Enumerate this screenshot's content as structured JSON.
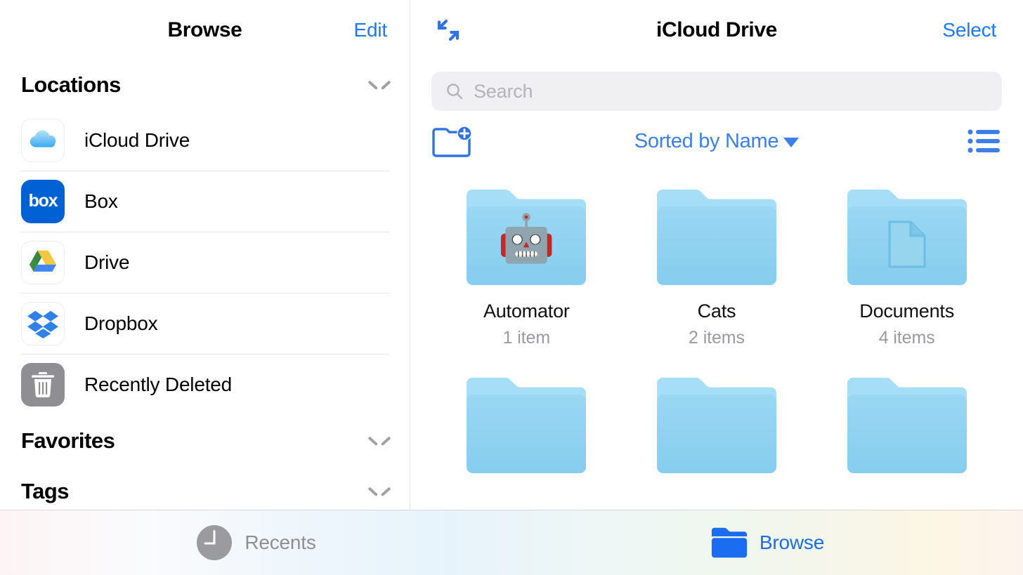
{
  "sidebar": {
    "title": "Browse",
    "edit_label": "Edit",
    "sections": [
      {
        "name": "locations",
        "title": "Locations",
        "chevron": "chevron-down-icon"
      },
      {
        "name": "favorites",
        "title": "Favorites",
        "chevron": "chevron-down-icon"
      },
      {
        "name": "tags",
        "title": "Tags",
        "chevron": "chevron-down-icon"
      }
    ],
    "locations": [
      {
        "label": "iCloud Drive",
        "icon": "icloud-icon"
      },
      {
        "label": "Box",
        "icon": "box-icon",
        "icon_text": "box"
      },
      {
        "label": "Drive",
        "icon": "google-drive-icon"
      },
      {
        "label": "Dropbox",
        "icon": "dropbox-icon"
      },
      {
        "label": "Recently Deleted",
        "icon": "trash-icon"
      }
    ]
  },
  "detail": {
    "title": "iCloud Drive",
    "select_label": "Select",
    "expand_icon": "expand-arrows-icon",
    "search": {
      "placeholder": "Search",
      "value": "",
      "icon": "search-icon"
    },
    "toolbar": {
      "new_folder_icon": "new-folder-icon",
      "sort_label": "Sorted by Name",
      "sort_caret": "caret-down-icon",
      "view_icon": "list-view-icon"
    },
    "items": [
      {
        "name": "Automator",
        "count": "1 item",
        "glyph": "robot",
        "emoji": "🤖"
      },
      {
        "name": "Cats",
        "count": "2 items",
        "glyph": "none",
        "emoji": ""
      },
      {
        "name": "Documents",
        "count": "4 items",
        "glyph": "document",
        "emoji": ""
      }
    ]
  },
  "tabbar": {
    "tabs": [
      {
        "label": "Recents",
        "icon": "clock-icon",
        "active": false
      },
      {
        "label": "Browse",
        "icon": "folder-icon",
        "active": true
      }
    ]
  },
  "colors": {
    "accent_blue": "#1a7af8",
    "sort_blue": "#3d7fe8",
    "folder_blue": "#8fd1f0",
    "inactive_gray": "#8e8e93",
    "secondary_text": "#9a9a9e",
    "search_bg": "#f0f0f2",
    "separator": "#e6e6e8"
  }
}
